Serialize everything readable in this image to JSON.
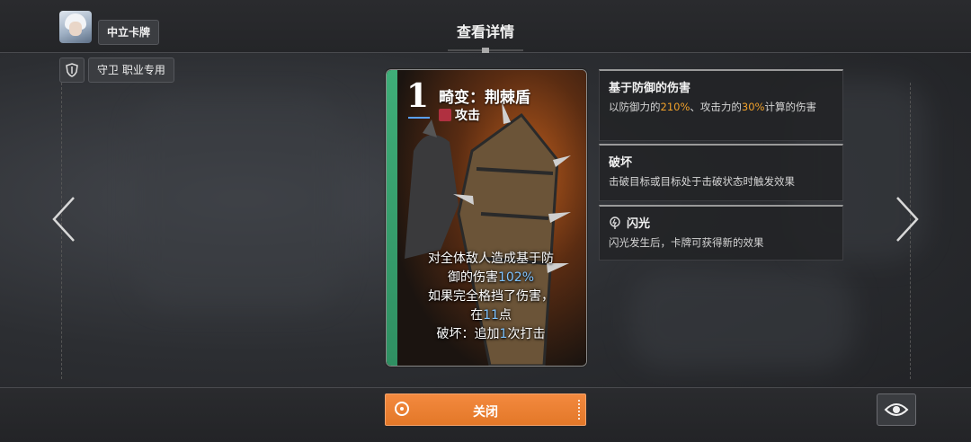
{
  "header": {
    "title": "查看详情",
    "category_label": "中立卡牌",
    "role_label": "守卫 职业专用"
  },
  "card": {
    "cost": "1",
    "name": "畸变：荆棘盾",
    "type": "攻击",
    "text_lines": [
      {
        "parts": [
          "对全体敌人造成基于防"
        ]
      },
      {
        "parts": [
          "御的伤害",
          "102%"
        ]
      },
      {
        "parts": [
          "如果完全格挡了伤害，"
        ]
      },
      {
        "parts": [
          "在",
          "11",
          "点"
        ]
      },
      {
        "parts": [
          "破坏：追加",
          "1",
          "次打击"
        ]
      }
    ],
    "stripe_color": "#3fae78",
    "highlight_color": "#7fc4ff"
  },
  "keywords": [
    {
      "title": "基于防御的伤害",
      "desc_prefix": "以防御力的",
      "value1": "210%",
      "desc_mid": "、攻击力的",
      "value2": "30%",
      "desc_suffix": "计算的伤害"
    },
    {
      "title": "破坏",
      "desc": "击破目标或目标处于击破状态时触发效果"
    },
    {
      "title": "闪光",
      "icon": "flash-icon",
      "desc": "闪光发生后，卡牌可获得新的效果"
    }
  ],
  "footer": {
    "close_label": "关闭",
    "accent_color": "#f08a38"
  }
}
